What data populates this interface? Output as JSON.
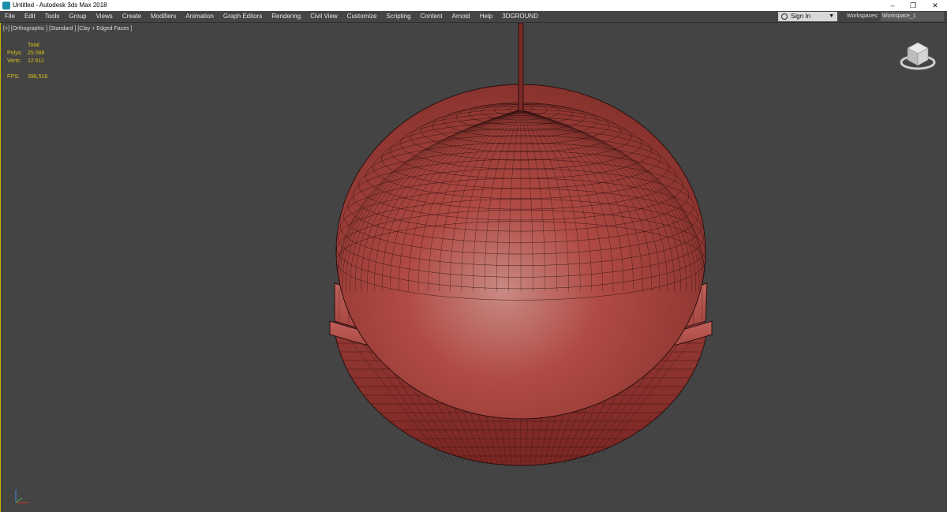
{
  "window": {
    "title": "Untitled - Autodesk 3ds Max 2018",
    "buttons": {
      "minimize": "–",
      "restore": "❐",
      "close": "✕"
    }
  },
  "menu": {
    "items": [
      "File",
      "Edit",
      "Tools",
      "Group",
      "Views",
      "Create",
      "Modifiers",
      "Animation",
      "Graph Editors",
      "Rendering",
      "Civil View",
      "Customize",
      "Scripting",
      "Content",
      "Arnold",
      "Help",
      "3DGROUND"
    ]
  },
  "signin": {
    "label": "Sign In",
    "icon": "user-icon"
  },
  "workspaces": {
    "label": "Workspaces:",
    "value": "Workspace_1"
  },
  "viewport": {
    "label": "[+] [Orthographic ] [Standard ] [Clay + Edged Faces ]",
    "stats": {
      "header": "Total",
      "polys_label": "Polys:",
      "polys": "25 088",
      "verts_label": "Verts:",
      "verts": "12 611",
      "fps_label": "FPS:",
      "fps": "398,518"
    },
    "model_color": "#b04a44",
    "wire_color": "#2a0f0d"
  }
}
